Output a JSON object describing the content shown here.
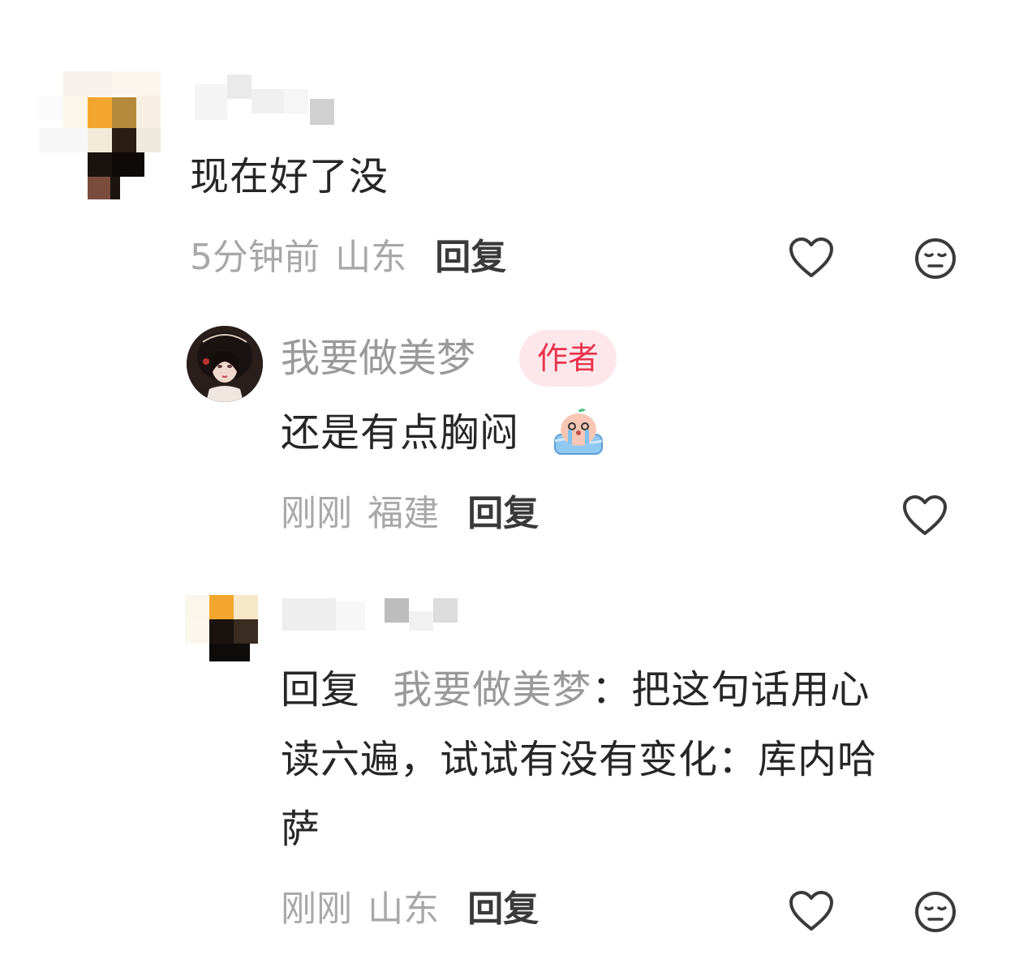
{
  "comments": [
    {
      "content": "现在好了没",
      "time": "5分钟前",
      "location": "山东",
      "reply_label": "回复"
    }
  ],
  "replies": [
    {
      "username": "我要做美梦",
      "badge": "作者",
      "content": "还是有点胸闷",
      "time": "刚刚",
      "location": "福建",
      "reply_label": "回复"
    },
    {
      "reply_prefix": "回复",
      "mention": "我要做美梦",
      "separator": "：",
      "content_line1": "把这句话用心",
      "content_line2": "读六遍，试试有没有变化：库内哈",
      "content_line3": "萨",
      "time": "刚刚",
      "location": "山东",
      "reply_label": "回复"
    }
  ],
  "icons": {
    "like": "heart-outline-icon",
    "dislike": "meh-face-icon",
    "emoji": "crying-emoji-icon"
  },
  "colors": {
    "badge_text": "#e8334d",
    "badge_bg": "#fde7ea",
    "meta": "#a8a8a8"
  }
}
